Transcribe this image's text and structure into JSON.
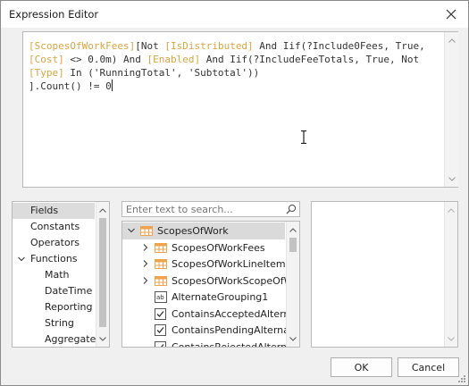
{
  "window": {
    "title": "Expression Editor"
  },
  "editor": {
    "lines": [
      [
        {
          "t": "field",
          "s": "[ScopesOfWorkFees]"
        },
        {
          "t": "plain",
          "s": "[Not "
        },
        {
          "t": "field",
          "s": "[IsDistributed]"
        },
        {
          "t": "plain",
          "s": " And Iif(?Include0Fees, True,"
        }
      ],
      [
        {
          "t": "field",
          "s": "[Cost]"
        },
        {
          "t": "plain",
          "s": " <> 0.0m) And "
        },
        {
          "t": "field",
          "s": "[Enabled]"
        },
        {
          "t": "plain",
          "s": " And Iif(?IncludeFeeTotals, True, Not"
        }
      ],
      [
        {
          "t": "field",
          "s": "[Type]"
        },
        {
          "t": "plain",
          "s": " In ('RunningTotal', 'Subtotal'))"
        }
      ],
      [
        {
          "t": "plain",
          "s": "].Count() != 0"
        }
      ]
    ]
  },
  "categories": {
    "items": [
      {
        "label": "Fields",
        "indent": 0,
        "selected": true,
        "expander": false
      },
      {
        "label": "Constants",
        "indent": 0,
        "selected": false,
        "expander": false
      },
      {
        "label": "Operators",
        "indent": 0,
        "selected": false,
        "expander": false
      },
      {
        "label": "Functions",
        "indent": 0,
        "selected": false,
        "expander": true
      },
      {
        "label": "Math",
        "indent": 1,
        "selected": false,
        "expander": false
      },
      {
        "label": "DateTime",
        "indent": 1,
        "selected": false,
        "expander": false
      },
      {
        "label": "Reporting",
        "indent": 1,
        "selected": false,
        "expander": false
      },
      {
        "label": "String",
        "indent": 1,
        "selected": false,
        "expander": false
      },
      {
        "label": "Aggregate",
        "indent": 1,
        "selected": false,
        "expander": false
      }
    ]
  },
  "search": {
    "placeholder": "Enter text to search..."
  },
  "fields_tree": {
    "items": [
      {
        "label": "ScopesOfWork",
        "level": 0,
        "chevron": "down",
        "icon": "table-icon",
        "selected": true
      },
      {
        "label": "ScopesOfWorkFees",
        "level": 1,
        "chevron": "right",
        "icon": "table-icon",
        "selected": false
      },
      {
        "label": "ScopesOfWorkLineItems",
        "level": 1,
        "chevron": "right",
        "icon": "table-icon",
        "selected": false
      },
      {
        "label": "ScopesOfWorkScopeOfW...",
        "level": 1,
        "chevron": "right",
        "icon": "table-icon",
        "selected": false
      },
      {
        "label": "AlternateGrouping1",
        "level": 1,
        "chevron": "none",
        "icon": "text-field-icon",
        "selected": false
      },
      {
        "label": "ContainsAcceptedAlternat...",
        "level": 1,
        "chevron": "none",
        "icon": "checkbox-icon",
        "selected": false
      },
      {
        "label": "ContainsPendingAlternates",
        "level": 1,
        "chevron": "none",
        "icon": "checkbox-icon",
        "selected": false
      },
      {
        "label": "ContainsRejectedAlternates",
        "level": 1,
        "chevron": "none",
        "icon": "checkbox-icon",
        "selected": false
      }
    ]
  },
  "buttons": {
    "ok": "OK",
    "cancel": "Cancel"
  },
  "colors": {
    "field": "#d9a441",
    "table_icon": "#f0a34a",
    "selection": "#dadada"
  }
}
